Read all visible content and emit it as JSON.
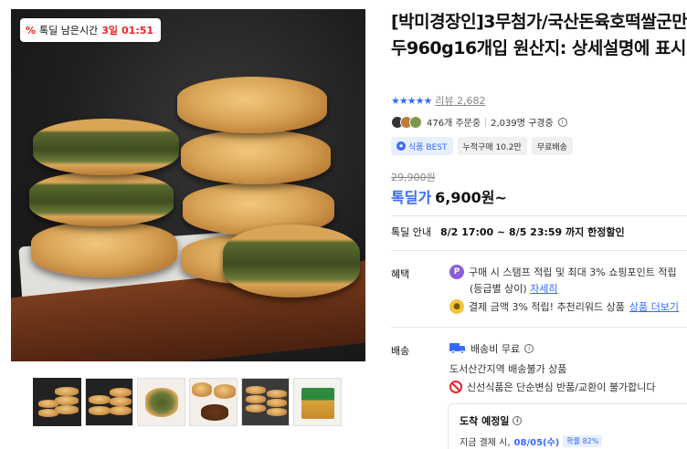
{
  "timer": {
    "prefix": "톡딜 남은시간",
    "days": "3일",
    "time": "01:51"
  },
  "product": {
    "title": "[박미경장인]3무첨가/국산돈육호떡쌀군만두960g16개입 원산지: 상세설명에 표시"
  },
  "rating": {
    "stars": "★★★★★",
    "review_label": "리뷰",
    "review_count": "2,682"
  },
  "buyers": {
    "orders": "476개 주문중",
    "subscribers": "2,039명 구경중"
  },
  "badges": {
    "best": "식품 BEST",
    "cumulative": "누적구매 10.2만",
    "free_shipping": "무료배송"
  },
  "price": {
    "original": "29,900원",
    "deal_label": "톡딜가",
    "deal_price": "6,900원~"
  },
  "deal_info": {
    "label": "톡딜 안내",
    "period": "8/2 17:00 ~ 8/5 23:59 까지 한정할인"
  },
  "benefits": {
    "label": "혜택",
    "line1": "구매 시 스탬프 적립 및 최대 3% 쇼핑포인트 적립",
    "line1_sub": "(등급별 상이)",
    "line1_link": "자세히",
    "line2_prefix": "결제 금액 3% 적립! 추천리워드 상품",
    "line2_link": "상품 더보기"
  },
  "shipping": {
    "label": "배송",
    "fee": "배송비 무료",
    "island": "도서산간지역 배송불가 상품",
    "notice": "신선식품은 단순변심 반품/교환이 불가합니다"
  },
  "arrival": {
    "title": "도착 예정일",
    "sub_prefix": "지금 결제 시,",
    "date": "08/05(수)",
    "probability": "확률 82%"
  }
}
